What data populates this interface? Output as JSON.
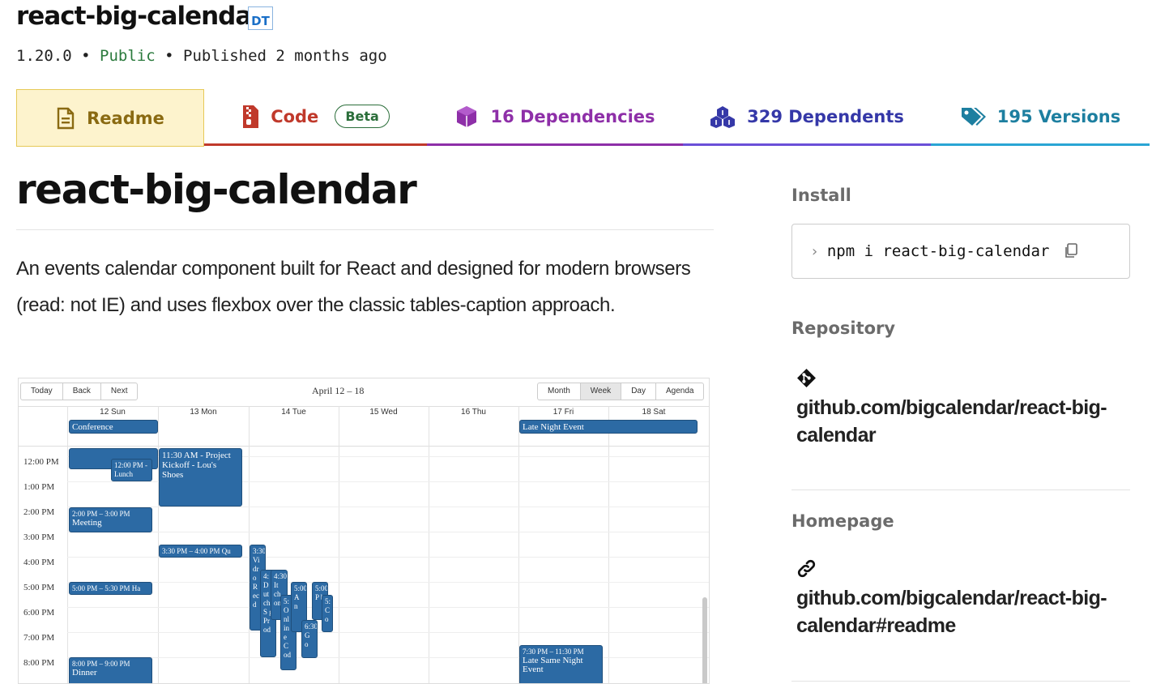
{
  "header": {
    "package_name": "react-big-calendar",
    "dt_badge": "DT",
    "version": "1.20.0",
    "separator": "•",
    "visibility": "Public",
    "published": "Published 2 months ago"
  },
  "tabs": [
    {
      "label": "Readme",
      "icon": "readme-icon",
      "color": "#8a6a12"
    },
    {
      "label": "Code",
      "badge": "Beta",
      "icon": "code-icon",
      "color": "#c0392b"
    },
    {
      "label": "16 Dependencies",
      "icon": "box-icon",
      "color": "#8e2fa8"
    },
    {
      "label": "329 Dependents",
      "icon": "boxes-icon",
      "color": "#3538a8"
    },
    {
      "label": "195 Versions",
      "icon": "tags-icon",
      "color": "#1d7fa0"
    }
  ],
  "readme": {
    "title": "react-big-calendar",
    "description": "An events calendar component built for React and designed for modern browsers (read: not IE) and uses flexbox over the classic tables-caption approach."
  },
  "calendar_image": {
    "nav_buttons": [
      "Today",
      "Back",
      "Next"
    ],
    "label": "April 12 – 18",
    "view_buttons": [
      "Month",
      "Week",
      "Day",
      "Agenda"
    ],
    "active_view": "Week",
    "days": [
      "12 Sun",
      "13 Mon",
      "14 Tue",
      "15 Wed",
      "16 Thu",
      "17 Fri",
      "18 Sat"
    ],
    "times": [
      "12:00 PM",
      "1:00 PM",
      "2:00 PM",
      "3:00 PM",
      "4:00 PM",
      "5:00 PM",
      "6:00 PM",
      "7:00 PM",
      "8:00 PM"
    ],
    "events": {
      "conference": "Conference",
      "late_night": "Late Night Event",
      "lunch": "12:00 PM - Lunch",
      "kickoff": "11:30 AM - Project Kickoff - Lou's Shoes",
      "meeting_time": "2:00 PM – 3:00 PM",
      "meeting": "Meeting",
      "qu": "3:30 PM – 4:00 PM Qu",
      "happy": "5:00 PM – 5:30 PM Ha",
      "dinner_time": "8:00 PM – 9:00 PM",
      "dinner": "Dinner",
      "late_same_time": "7:30 PM – 11:30 PM",
      "late_same": "Late Same Night Event",
      "stack1": "3:30 Vi dr o R ec d",
      "stack2": "4: D ut ch S g Pr od",
      "stack3": "4:30 It ch on",
      "stack4": "5: O nl in e C od",
      "stack5": "5:00 A n",
      "stack6": "6:30 G o",
      "stack7": "5:00 P b",
      "stack8": "5: C o"
    }
  },
  "sidebar": {
    "install_heading": "Install",
    "install_prompt": "›",
    "install_cmd": "npm i react-big-calendar",
    "repository_heading": "Repository",
    "repository_link": "github.com/bigcalendar/react-big-calendar",
    "homepage_heading": "Homepage",
    "homepage_link": "github.com/bigcalendar/react-big-calendar#readme"
  }
}
